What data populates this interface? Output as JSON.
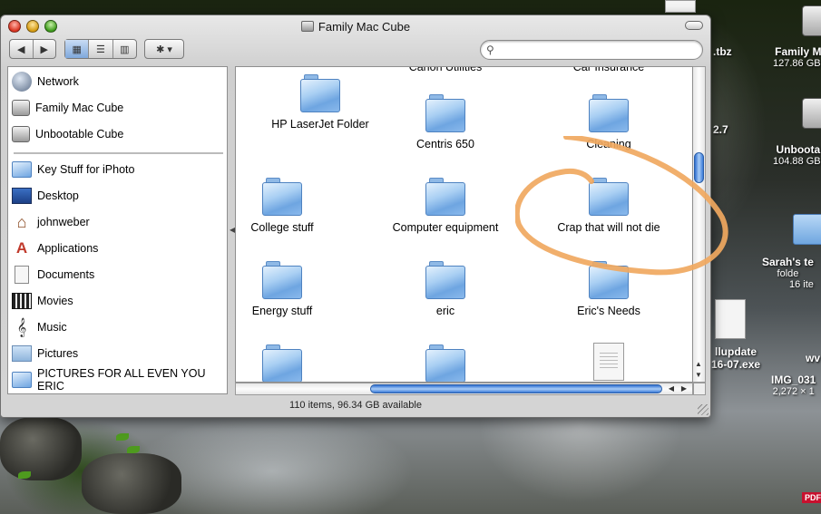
{
  "window": {
    "title": "Family Mac Cube",
    "status": "110 items, 96.34 GB available",
    "search_placeholder": ""
  },
  "toolbar": {
    "back_label": "◀",
    "forward_label": "▶",
    "view_icon_label": "▦",
    "view_list_label": "☰",
    "view_column_label": "▥",
    "action_label": "✱ ▾"
  },
  "sidebar": {
    "devices": [
      {
        "label": "Network",
        "icon": "network-icon"
      },
      {
        "label": "Family Mac Cube",
        "icon": "hard-drive-icon"
      },
      {
        "label": "Unbootable Cube",
        "icon": "hard-drive-icon"
      }
    ],
    "places": [
      {
        "label": "Key Stuff for iPhoto",
        "icon": "folder-icon"
      },
      {
        "label": "Desktop",
        "icon": "desktop-icon"
      },
      {
        "label": "johnweber",
        "icon": "home-icon"
      },
      {
        "label": "Applications",
        "icon": "applications-icon"
      },
      {
        "label": "Documents",
        "icon": "documents-icon"
      },
      {
        "label": "Movies",
        "icon": "movies-icon"
      },
      {
        "label": "Music",
        "icon": "music-icon"
      },
      {
        "label": "Pictures",
        "icon": "pictures-icon"
      },
      {
        "label": "PICTURES FOR ALL EVEN YOU ERIC",
        "icon": "folder-icon"
      }
    ]
  },
  "main": {
    "clipped_labels": [
      "Canon Utilities",
      "Car Insurance"
    ],
    "items": [
      {
        "label": "HP LaserJet Folder"
      },
      {
        "label": "Centris 650"
      },
      {
        "label": "Cleaning"
      },
      {
        "label": "College stuff"
      },
      {
        "label": "Computer equipment"
      },
      {
        "label": "Crap that will not die"
      },
      {
        "label": "Energy stuff"
      },
      {
        "label": "eric"
      },
      {
        "label": "Eric's Needs"
      }
    ]
  },
  "desktop": {
    "items": [
      {
        "label": "Family M",
        "sub": "127.86 GB,"
      },
      {
        "label": "Unboota",
        "sub": "104.88 GB,"
      },
      {
        "label": "Sarah's te",
        "sub": "folde"
      },
      {
        "label": "",
        "sub": "16 ite"
      },
      {
        "label": "llupdate",
        "sub": "16-07.exe"
      },
      {
        "label": "IMG_031",
        "sub": "2,272 × 1"
      },
      {
        "label": ".tbz",
        "sub": ""
      },
      {
        "label": "2.7",
        "sub": ""
      },
      {
        "label": "wv",
        "sub": ""
      }
    ],
    "pdf_badge": "PDF"
  },
  "colors": {
    "annotation": "#f0a860",
    "scroll_accent": "#3a7bd8"
  }
}
